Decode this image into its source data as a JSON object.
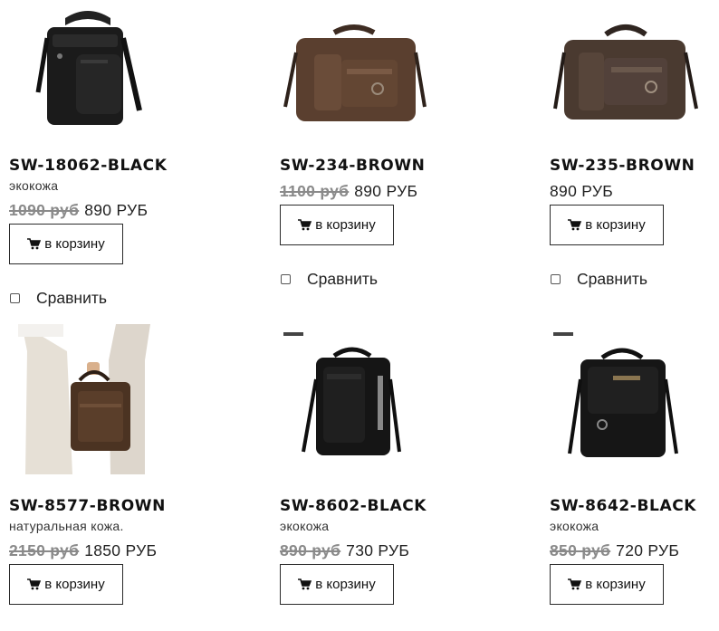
{
  "products": [
    {
      "sku": "SW-18062-BLACK",
      "material": "экокожа",
      "old_price": "1090 руб",
      "price": "890 РУБ",
      "cart_label": "в корзину",
      "compare_label": "Сравнить",
      "image_color": "#1b1b1b"
    },
    {
      "sku": "SW-234-BROWN",
      "old_price": "1100 руб",
      "price": "890 РУБ",
      "cart_label": "в корзину",
      "compare_label": "Сравнить",
      "image_color": "#5a3f2f"
    },
    {
      "sku": "SW-235-BROWN",
      "price": "890 РУБ",
      "cart_label": "в корзину",
      "compare_label": "Сравнить",
      "image_color": "#4a3a30"
    },
    {
      "sku": "SW-8577-BROWN",
      "material": "натуральная кожа.",
      "old_price": "2150 руб",
      "price": "1850 РУБ",
      "cart_label": "в корзину",
      "image_color": "#4b3322"
    },
    {
      "sku": "SW-8602-BLACK",
      "material": "экокожа",
      "old_price": "890 руб",
      "price": "730 РУБ",
      "cart_label": "в корзину",
      "image_color": "#151515"
    },
    {
      "sku": "SW-8642-BLACK",
      "material": "экокожа",
      "old_price": "850 руб",
      "price": "720 РУБ",
      "cart_label": "в корзину",
      "image_color": "#161616"
    }
  ],
  "colors": {
    "old_price": "#8a8a8a",
    "button_border": "#2a2a2a"
  },
  "icons": {
    "cart": "shopping-cart-icon",
    "compare": "checkbox"
  }
}
